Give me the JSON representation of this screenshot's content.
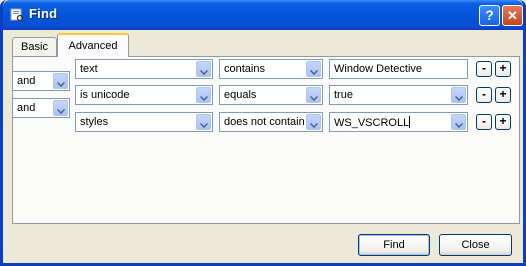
{
  "window": {
    "title": "Find",
    "help_label": "?",
    "close_label": "✕"
  },
  "tabs": [
    {
      "label": "Basic"
    },
    {
      "label": "Advanced"
    }
  ],
  "rows": [
    {
      "field": "text",
      "operator": "contains",
      "value": "Window Detective",
      "minus": "-",
      "plus": "+"
    },
    {
      "connector": "and",
      "field": "is unicode",
      "operator": "equals",
      "value": "true",
      "minus": "-",
      "plus": "+"
    },
    {
      "connector": "and",
      "field": "styles",
      "operator": "does not contain",
      "value": "WS_VSCROLL",
      "minus": "-",
      "plus": "+"
    }
  ],
  "buttons": {
    "find": "Find",
    "close": "Close"
  }
}
